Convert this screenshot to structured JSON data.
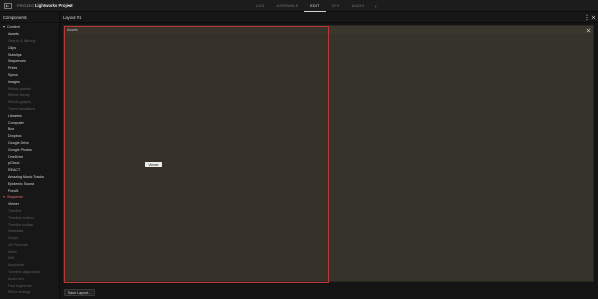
{
  "topbar": {
    "project_label": "PROJECT",
    "project_name": "Lightworks Project",
    "tabs": [
      {
        "label": "LOG",
        "active": false
      },
      {
        "label": "ASSEMBLE",
        "active": false
      },
      {
        "label": "EDIT",
        "active": true
      },
      {
        "label": "VFX",
        "active": false
      },
      {
        "label": "AUDIO",
        "active": false
      }
    ],
    "add_tab_label": "+"
  },
  "sidebar": {
    "header": "Components",
    "sections": [
      {
        "label": "Content",
        "color": "#d4d4d4",
        "items": [
          {
            "label": "Assets",
            "enabled": true
          },
          {
            "label": "Search & filtering",
            "enabled": false
          },
          {
            "label": "Clips",
            "enabled": true
          },
          {
            "label": "Subclips",
            "enabled": true
          },
          {
            "label": "Sequences",
            "enabled": true
          },
          {
            "label": "Prints",
            "enabled": true
          },
          {
            "label": "Syncs",
            "enabled": true
          },
          {
            "label": "Images",
            "enabled": true
          },
          {
            "label": "Effects palette",
            "enabled": false
          },
          {
            "label": "Effects library",
            "enabled": false
          },
          {
            "label": "Effects graphs",
            "enabled": false
          },
          {
            "label": "Timed transitions",
            "enabled": false
          },
          {
            "label": "Libraries",
            "enabled": true
          },
          {
            "label": "Computer",
            "enabled": true
          },
          {
            "label": "Box",
            "enabled": true
          },
          {
            "label": "Dropbox",
            "enabled": true
          },
          {
            "label": "Google Drive",
            "enabled": true
          },
          {
            "label": "Google Photos",
            "enabled": true
          },
          {
            "label": "OneDrive",
            "enabled": true
          },
          {
            "label": "pCloud",
            "enabled": true
          },
          {
            "label": "REACT",
            "enabled": true
          },
          {
            "label": "Amazing Music Tracks",
            "enabled": true
          },
          {
            "label": "Epidemic Sound",
            "enabled": true
          },
          {
            "label": "Pond5",
            "enabled": true
          }
        ]
      },
      {
        "label": "Sequence",
        "color": "#e86a6a",
        "items": [
          {
            "label": "Viewer",
            "enabled": true
          },
          {
            "label": "Timeline",
            "enabled": false
          },
          {
            "label": "Timeline toolbox",
            "enabled": false
          },
          {
            "label": "Timeline toolbar",
            "enabled": false
          },
          {
            "label": "Metadata",
            "enabled": false
          },
          {
            "label": "Scope",
            "enabled": false
          },
          {
            "label": "UC Records",
            "enabled": false
          },
          {
            "label": "Mixer",
            "enabled": false
          },
          {
            "label": "Edit",
            "enabled": false
          },
          {
            "label": "Amplitude",
            "enabled": false
          },
          {
            "label": "Timeline diagnostics",
            "enabled": false
          },
          {
            "label": "Audio mix",
            "enabled": false
          },
          {
            "label": "Find segments",
            "enabled": false
          },
          {
            "label": "Effect settings",
            "enabled": false
          }
        ]
      }
    ]
  },
  "main": {
    "layout_title": "Layout #1",
    "panel": {
      "title": "Assets",
      "viewer_chip": "Viewer"
    },
    "save_button": "Save Layout..."
  },
  "colors": {
    "accent_red": "#b83838",
    "panel_bg": "#35332a",
    "app_bg": "#131313"
  },
  "icons": [
    "back-icon",
    "chevron-down-icon",
    "kebab-menu-icon",
    "close-icon",
    "panel-close-icon"
  ]
}
